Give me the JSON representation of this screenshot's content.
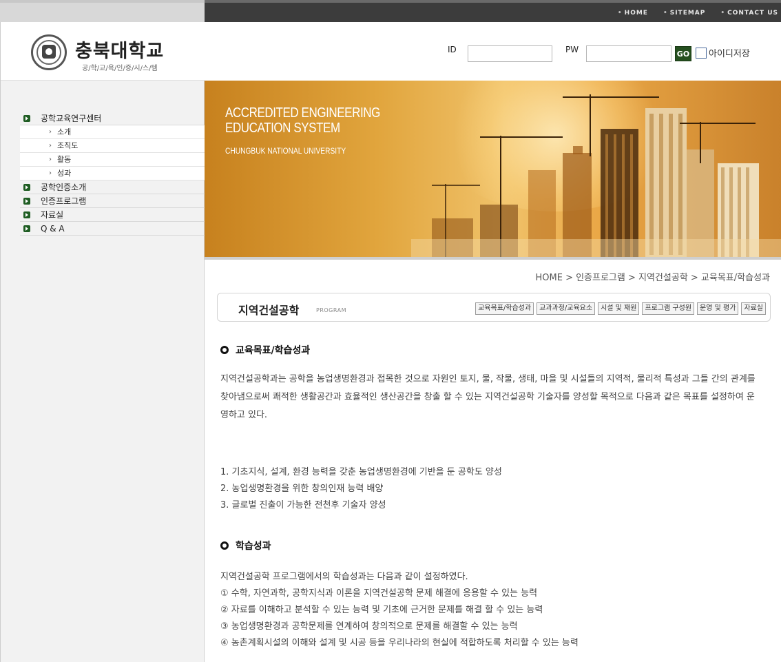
{
  "top_links": [
    "HOME",
    "SITEMAP",
    "CONTACT US"
  ],
  "logo": {
    "name": "충북대학교",
    "subtitle": "공/학/교/육/인/증/시/스/템"
  },
  "login": {
    "id_label": "ID",
    "pw_label": "PW",
    "go_label": "GO",
    "save_label": "아이디저장"
  },
  "banner": {
    "line1": "ACCREDITED ENGINEERING",
    "line2": "EDUCATION SYSTEM",
    "line3": "CHUNGBUK NATIONAL UNIVERSITY"
  },
  "sidebar": {
    "items": [
      {
        "label": "공학교육연구센터",
        "subs": [
          "소개",
          "조직도",
          "활동",
          "성과"
        ]
      },
      {
        "label": "공학인증소개"
      },
      {
        "label": "인증프로그램"
      },
      {
        "label": "자료실"
      },
      {
        "label": "Q & A"
      }
    ]
  },
  "breadcrumb": "HOME > 인증프로그램 > 지역건설공학 > 교육목표/학습성과",
  "program": {
    "name": "지역건설공학",
    "tag": "PROGRAM",
    "tabs": [
      "교육목표/학습성과",
      "교과과정/교육요소",
      "시설 및 재원",
      "프로그램 구성원",
      "운영 및 평가",
      "자료실"
    ]
  },
  "content": {
    "section1_title": "교육목표/학습성과",
    "intro": "지역건설공학과는 공학을 농업생명환경과 접목한 것으로 자원인 토지, 물, 작물, 생태, 마을 및 시설들의 지역적, 물리적 특성과 그들 간의 관계를 찾아냄으로써 쾌적한 생활공간과 효율적인 생산공간을 창출 할 수 있는 지역건설공학 기술자를 양성할 목적으로 다음과 같은 목표를 설정하여 운영하고 있다.",
    "goals": [
      "1. 기초지식, 설계, 환경 능력을 갖춘 농업생명환경에 기반을 둔 공학도 양성",
      "2. 농업생명환경을 위한 창의인재 능력 배양",
      "3. 글로벌 진출이 가능한 전천후 기술자 양성"
    ],
    "section2_title": "학습성과",
    "outcomes_intro": "지역건설공학 프로그램에서의 학습성과는 다음과 같이 설정하였다.",
    "outcomes": [
      "① 수학, 자연과학, 공학지식과 이론을 지역건설공학 문제 해결에 응용할 수 있는 능력",
      "② 자료를 이해하고 분석할 수 있는 능력 및 기초에 근거한 문제를 해결 할 수 있는 능력",
      "③ 농업생명환경과 공학문제를 연계하여 창의적으로 문제를 해결할 수 있는 능력",
      "④ 농촌계획시설의 이해와 설계 및 시공 등을 우리나라의 현실에 적합하도록 처리할 수 있는 능력"
    ]
  },
  "colors": {
    "go_button": "#254f1f",
    "menu_bullet": "#1f5d23",
    "top_bar": "#3c3c3c"
  }
}
